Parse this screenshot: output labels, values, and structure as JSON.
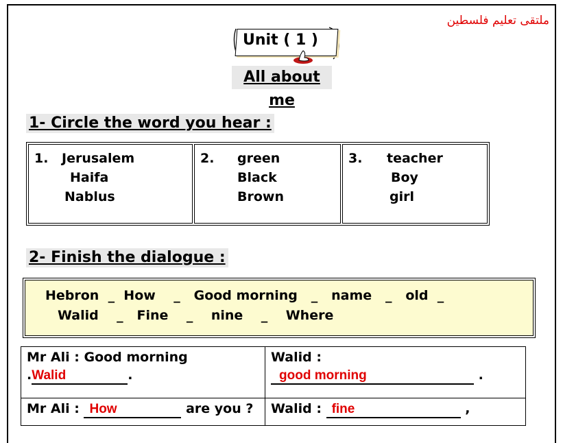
{
  "header": {
    "site_name": "ملتقى تعليم فلسطين",
    "unit_title": "Unit ( 1 )",
    "subtitle": "All about me"
  },
  "section1": {
    "heading": "1- Circle the word you hear :",
    "groups": [
      {
        "number": "1.",
        "words": [
          "Jerusalem",
          "Haifa",
          "Nablus"
        ]
      },
      {
        "number": "2.",
        "words": [
          "green",
          "Black",
          "Brown"
        ]
      },
      {
        "number": "3.",
        "words": [
          "teacher",
          "Boy",
          "girl"
        ]
      }
    ]
  },
  "section2": {
    "heading": "2- Finish the dialogue :",
    "word_bank_row1": "Hebron  _  How    _   Good morning   _   name   _   old  _",
    "word_bank_row2": "Walid    _   Fine    _    nine    _    Where",
    "dialogue": {
      "r1_left_speaker": "Mr Ali :",
      "r1_left_text": "Good morning",
      "r1_left_answer": "Walid",
      "r1_right_speaker": "Walid :",
      "r1_right_answer": "good morning",
      "r2_left_speaker": "Mr Ali :",
      "r2_left_answer": "How",
      "r2_left_suffix": "are you ?",
      "r2_right_speaker": "Walid :",
      "r2_right_answer": "fine"
    }
  },
  "colors": {
    "answer_red": "#e00000",
    "word_bank_bg": "#fdfbd0"
  },
  "icons": [
    "scroll-icon",
    "hand-icon"
  ]
}
